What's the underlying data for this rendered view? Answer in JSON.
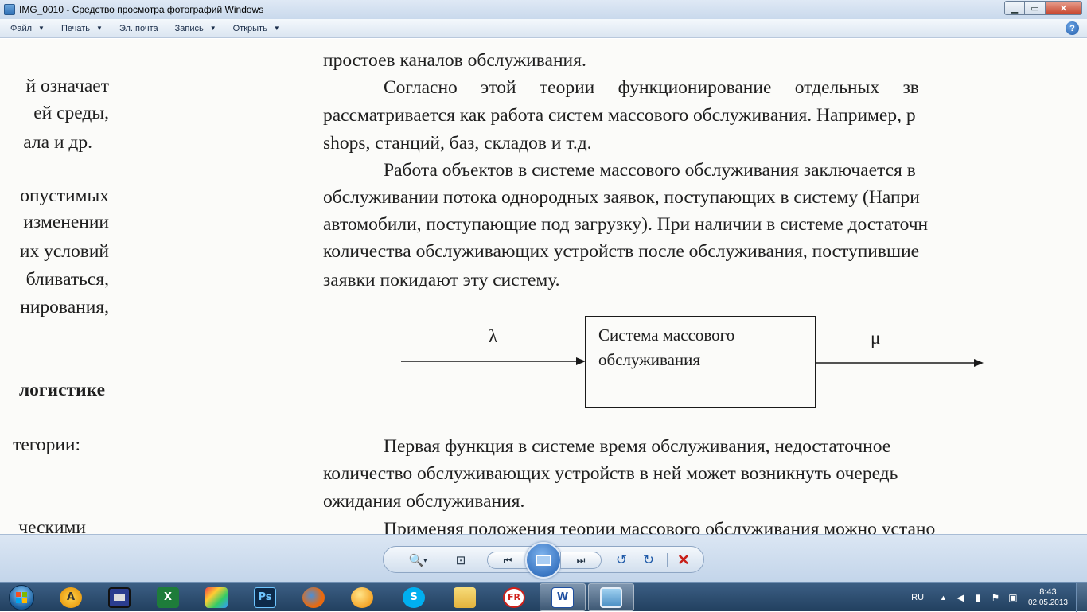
{
  "window": {
    "title": "IMG_0010 - Средство просмотра фотографий Windows"
  },
  "menu": {
    "items": [
      {
        "label": "Файл"
      },
      {
        "label": "Печать"
      },
      {
        "label": "Эл. почта"
      },
      {
        "label": "Запись"
      },
      {
        "label": "Открыть"
      }
    ]
  },
  "document": {
    "left_column": [
      "й  означает",
      "ей   среды,",
      "ала и др.",
      "опустимых",
      "изменении",
      "их  условий",
      "бливаться,",
      "нирования,",
      "логистике",
      "тегории:",
      "ческими"
    ],
    "right_column": [
      "простоев каналов обслуживания.",
      "Согласно     этой     теории     функционирование     отдельных     зв",
      "рассматривается как работа систем массового обслуживания. Например, р",
      "shops, станций, баз, складов и т.д.",
      "Работа объектов в системе массового обслуживания заключается в",
      "обслуживании потока однородных заявок, поступающих в систему (Напри",
      "автомобили, поступающие под загрузку). При наличии в системе достаточн",
      "количества обслуживающих устройств после обслуживания, поступившие",
      "заявки покидают эту систему.",
      "Первая функция в системе время обслуживания, недостаточное",
      "количество обслуживающих устройств в ней может возникнуть очередь",
      "ожидания обслуживания.",
      "Применяя положения теории массового обслуживания можно устано"
    ],
    "diagram": {
      "input_label": "λ",
      "output_label": "μ",
      "box_line1": "Система массового",
      "box_line2": "обслуживания"
    }
  },
  "taskbar": {
    "apps": [
      {
        "icon": "aimp-icon",
        "text": "A"
      },
      {
        "icon": "save-disk-icon",
        "text": ""
      },
      {
        "icon": "excel-icon",
        "text": "X"
      },
      {
        "icon": "paint-icon",
        "text": ""
      },
      {
        "icon": "photoshop-icon",
        "text": "Ps"
      },
      {
        "icon": "firefox-icon",
        "text": ""
      },
      {
        "icon": "gold-sphere-icon",
        "text": ""
      },
      {
        "icon": "skype-icon",
        "text": "S"
      },
      {
        "icon": "explorer-folder-icon",
        "text": ""
      },
      {
        "icon": "finereader-icon",
        "text": "FR"
      },
      {
        "icon": "word-icon",
        "text": "W"
      },
      {
        "icon": "photo-viewer-icon",
        "text": ""
      }
    ],
    "tray": {
      "language": "RU",
      "time": "8:43",
      "date": "02.05.2013"
    }
  }
}
